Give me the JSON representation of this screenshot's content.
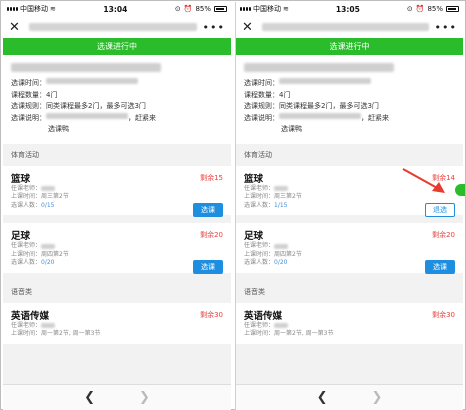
{
  "screens": [
    {
      "status": {
        "carrier": "中国移动",
        "time": "13:04",
        "battery": "85%"
      },
      "banner": "选课进行中",
      "info": {
        "time_label": "选课时间：",
        "count_label": "课程数量：",
        "count_value": "4门",
        "rule_label": "选课规则：",
        "rule_value": "同类课程最多2门，最多可选3门",
        "desc_label": "选课说明：",
        "desc_value": "，赶紧来",
        "desc_value2": "选课鸭"
      },
      "sections": [
        {
          "title": "体育活动",
          "courses": [
            {
              "name": "篮球",
              "remain": "剩余15",
              "teacher_label": "任课老师：",
              "time_label": "上课时间：",
              "time_value": "周三第2节",
              "count_label": "选课人数：",
              "count_value": "0/15",
              "button": "选课",
              "button_style": "primary"
            },
            {
              "name": "足球",
              "remain": "剩余20",
              "teacher_label": "任课老师：",
              "time_label": "上课时间：",
              "time_value": "周四第2节",
              "count_label": "选课人数：",
              "count_value": "0/20",
              "button": "选课",
              "button_style": "primary"
            }
          ]
        },
        {
          "title": "语音类",
          "courses": [
            {
              "name": "英语传媒",
              "remain": "剩余30",
              "teacher_label": "任课老师：",
              "time_label": "上课时间：",
              "time_value": "周一第2节, 周一第3节"
            }
          ]
        }
      ]
    },
    {
      "status": {
        "carrier": "中国移动",
        "time": "13:05",
        "battery": "85%"
      },
      "banner": "选课进行中",
      "info": {
        "time_label": "选课时间：",
        "count_label": "课程数量：",
        "count_value": "4门",
        "rule_label": "选课规则：",
        "rule_value": "同类课程最多2门，最多可选3门",
        "desc_label": "选课说明：",
        "desc_value": "，赶紧来",
        "desc_value2": "选课鸭"
      },
      "sections": [
        {
          "title": "体育活动",
          "courses": [
            {
              "name": "篮球",
              "remain": "剩余14",
              "teacher_label": "任课老师：",
              "time_label": "上课时间：",
              "time_value": "周三第2节",
              "count_label": "选课人数：",
              "count_value": "1/15",
              "button": "退选",
              "button_style": "outline"
            },
            {
              "name": "足球",
              "remain": "剩余20",
              "teacher_label": "任课老师：",
              "time_label": "上课时间：",
              "time_value": "周四第2节",
              "count_label": "选课人数：",
              "count_value": "0/20",
              "button": "选课",
              "button_style": "primary"
            }
          ]
        },
        {
          "title": "语音类",
          "courses": [
            {
              "name": "英语传媒",
              "remain": "剩余30",
              "teacher_label": "任课老师：",
              "time_label": "上课时间：",
              "time_value": "周一第2节, 周一第3节"
            }
          ]
        }
      ]
    }
  ],
  "colors": {
    "green": "#2bbc2b",
    "blue": "#1e8fe0",
    "red": "#e64340",
    "annotation_arrow": "#e83a2e"
  },
  "icons": {
    "close": "close-icon",
    "more": "more-icon",
    "back": "back-arrow-icon",
    "forward": "forward-arrow-icon"
  }
}
